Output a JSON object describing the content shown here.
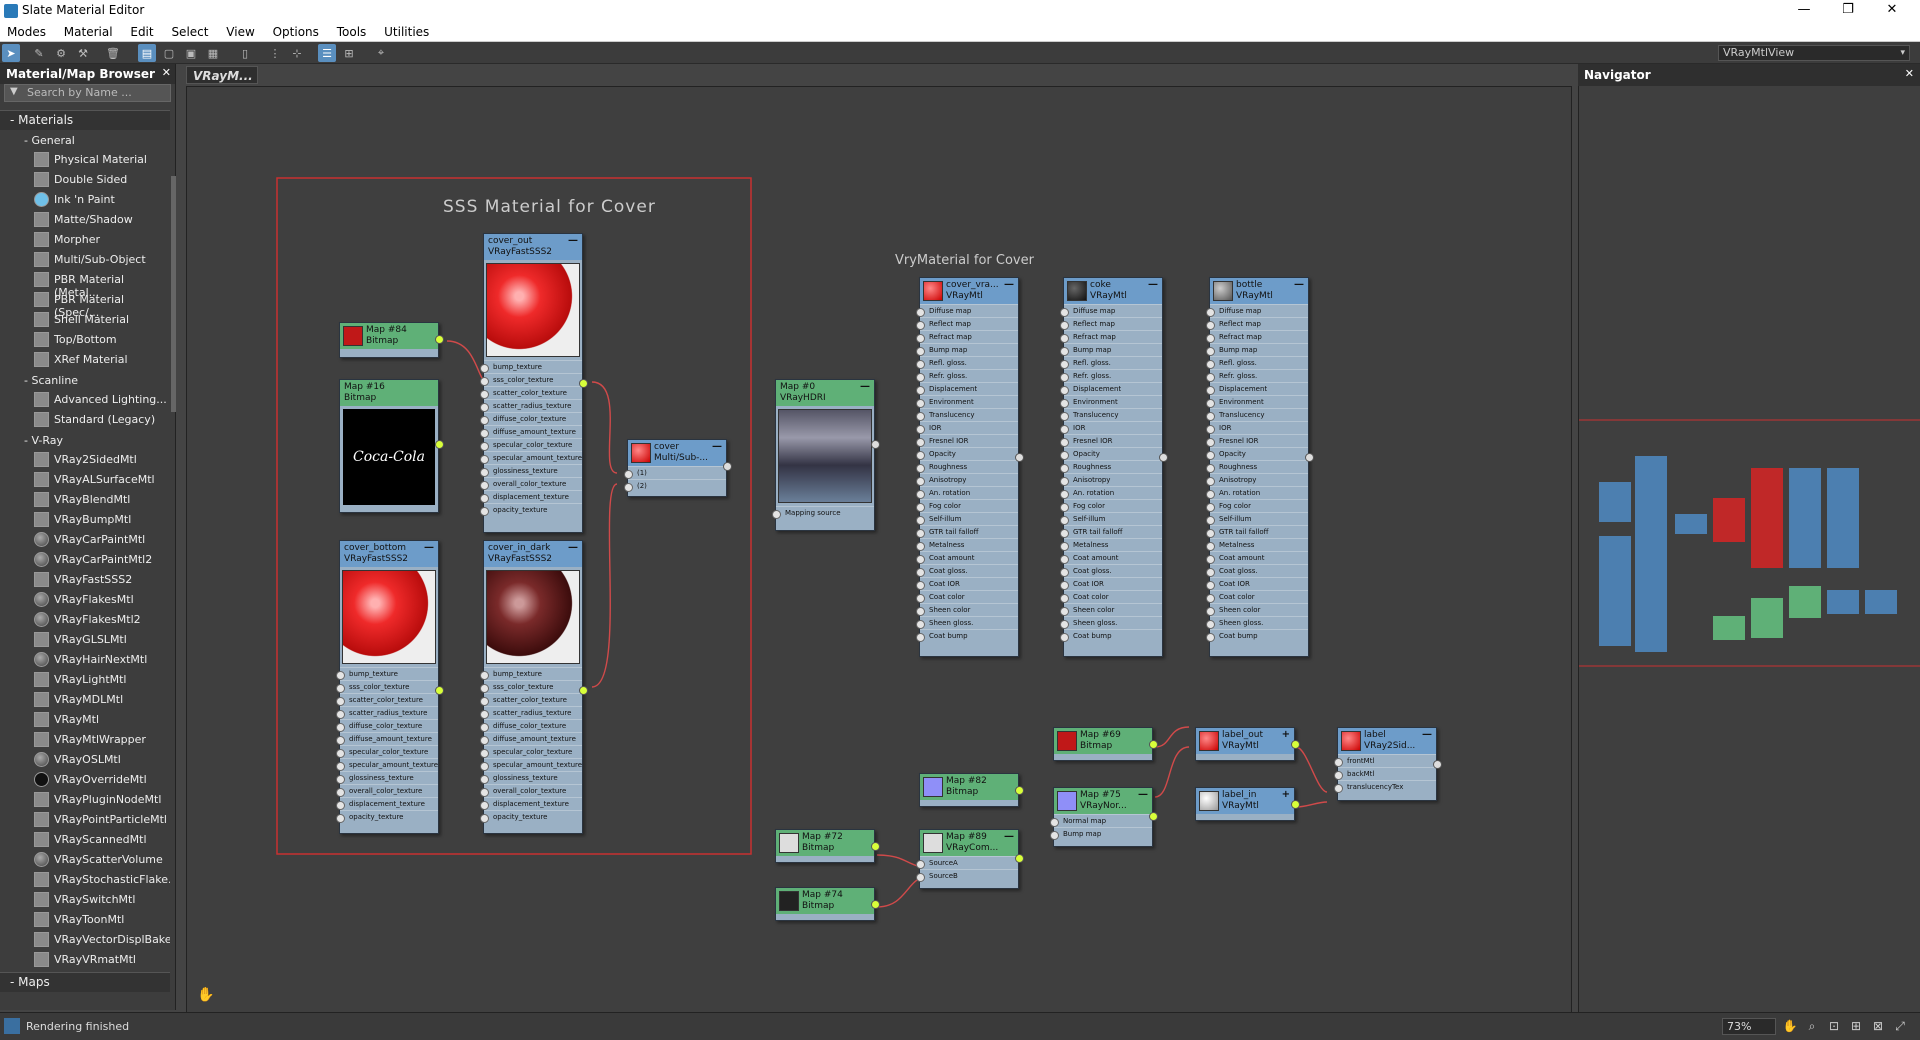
{
  "window": {
    "title": "Slate Material Editor",
    "buttons": [
      "—",
      "❐",
      "✕"
    ]
  },
  "menu": [
    "Modes",
    "Material",
    "Edit",
    "Select",
    "View",
    "Options",
    "Tools",
    "Utilities"
  ],
  "toolbar": {
    "view_select": "VRayMtlView"
  },
  "browser": {
    "title": "Material/Map Browser",
    "search_placeholder": "Search by Name ...",
    "materials_label": "Materials",
    "general_label": "General",
    "general": [
      "Physical Material",
      "Double Sided",
      "Ink 'n Paint",
      "Matte/Shadow",
      "Morpher",
      "Multi/Sub-Object",
      "PBR Material (Metal...",
      "PBR Material (Spec/...",
      "Shell Material",
      "Top/Bottom",
      "XRef Material"
    ],
    "scanline_label": "Scanline",
    "scanline": [
      "Advanced Lighting...",
      "Standard (Legacy)"
    ],
    "vray_label": "V-Ray",
    "vray": [
      "VRay2SidedMtl",
      "VRayALSurfaceMtl",
      "VRayBlendMtl",
      "VRayBumpMtl",
      "VRayCarPaintMtl",
      "VRayCarPaintMtl2",
      "VRayFastSSS2",
      "VRayFlakesMtl",
      "VRayFlakesMtl2",
      "VRayGLSLMtl",
      "VRayHairNextMtl",
      "VRayLightMtl",
      "VRayMDLMtl",
      "VRayMtl",
      "VRayMtlWrapper",
      "VRayOSLMtl",
      "VRayOverrideMtl",
      "VRayPluginNodeMtl",
      "VRayPointParticleMtl",
      "VRayScannedMtl",
      "VRayScatterVolume",
      "VRayStochasticFlake...",
      "VRaySwitchMtl",
      "VRayToonMtl",
      "VRayVectorDisplBake",
      "VRayVRmatMtl"
    ],
    "maps_label": "Maps"
  },
  "view": {
    "tab": "VRayM...",
    "frame_title": "SSS Material for Cover",
    "note": "VryMaterial for Cover",
    "coca_cola": "Coca-Cola",
    "nodes": {
      "cover_out": {
        "name": "cover_out",
        "type": "VRayFastSSS2"
      },
      "cover_bottom": {
        "name": "cover_bottom",
        "type": "VRayFastSSS2"
      },
      "cover_in_dark": {
        "name": "cover_in_dark",
        "type": "VRayFastSSS2"
      },
      "map84": {
        "name": "Map #84",
        "type": "Bitmap"
      },
      "map16": {
        "name": "Map #16",
        "type": "Bitmap"
      },
      "cover": {
        "name": "cover",
        "type": "Multi/Sub-..."
      },
      "map0": {
        "name": "Map #0",
        "type": "VRayHDRI",
        "slot": "Mapping source"
      },
      "cover_vray": {
        "name": "cover_vra...",
        "type": "VRayMtl"
      },
      "coke": {
        "name": "coke",
        "type": "VRayMtl"
      },
      "bottle": {
        "name": "bottle",
        "type": "VRayMtl"
      },
      "map69": {
        "name": "Map #69",
        "type": "Bitmap"
      },
      "label_out": {
        "name": "label_out",
        "type": "VRayMtl"
      },
      "label_in": {
        "name": "label_in",
        "type": "VRayMtl"
      },
      "label": {
        "name": "label",
        "type": "VRay2Sid..."
      },
      "map82": {
        "name": "Map #82",
        "type": "Bitmap"
      },
      "map75": {
        "name": "Map #75",
        "type": "VRayNor..."
      },
      "map89": {
        "name": "Map #89",
        "type": "VRayCom..."
      },
      "map72": {
        "name": "Map #72",
        "type": "Bitmap"
      },
      "map74": {
        "name": "Map #74",
        "type": "Bitmap"
      }
    },
    "sss_slots": [
      "bump_texture",
      "sss_color_texture",
      "scatter_color_texture",
      "scatter_radius_texture",
      "diffuse_color_texture",
      "diffuse_amount_texture",
      "specular_color_texture",
      "specular_amount_texture",
      "glossiness_texture",
      "overall_color_texture",
      "displacement_texture",
      "opacity_texture"
    ],
    "multi_slots": [
      "(1)",
      "(2)"
    ],
    "vray_slots": [
      "Diffuse map",
      "Reflect map",
      "Refract map",
      "Bump map",
      "Refl. gloss.",
      "Refr. gloss.",
      "Displacement",
      "Environment",
      "Translucency",
      "IOR",
      "Fresnel IOR",
      "Opacity",
      "Roughness",
      "Anisotropy",
      "An. rotation",
      "Fog color",
      "Self-illum",
      "GTR tail falloff",
      "Metalness",
      "Coat amount",
      "Coat gloss.",
      "Coat IOR",
      "Coat color",
      "Sheen color",
      "Sheen gloss.",
      "Coat bump"
    ],
    "twosided_slots": [
      "frontMtl",
      "backMtl",
      "translucencyTex"
    ],
    "normal_slots": [
      "Normal map",
      "Bump map"
    ],
    "composite_slots": [
      "SourceA",
      "SourceB"
    ]
  },
  "navigator": {
    "title": "Navigator"
  },
  "status": {
    "text": "Rendering finished",
    "zoom": "73%"
  }
}
